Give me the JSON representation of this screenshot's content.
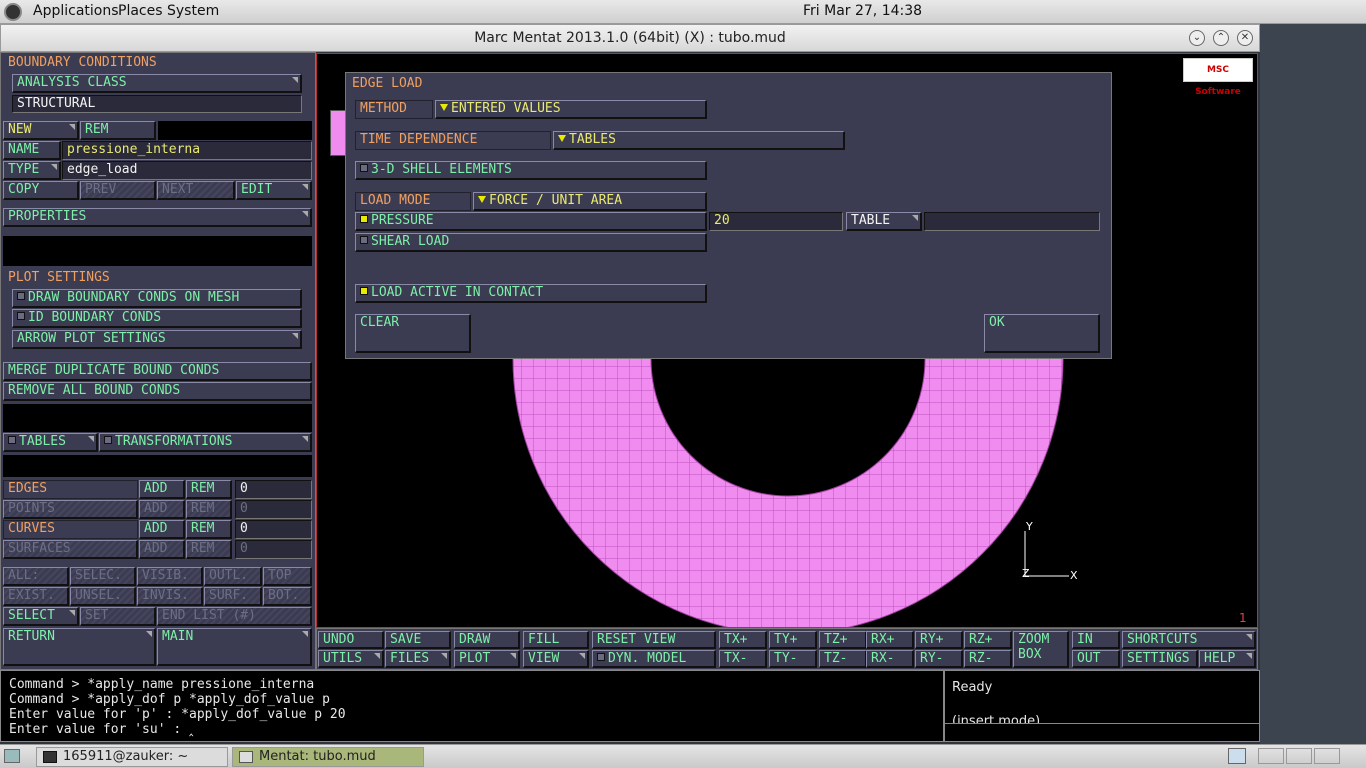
{
  "top_panel": {
    "applications": "Applications",
    "places": "Places",
    "system": "System",
    "clock": "Fri Mar 27, 14:38"
  },
  "window": {
    "title": "Marc Mentat 2013.1.0 (64bit) (X) : tubo.mud"
  },
  "left": {
    "boundary_conditions": "BOUNDARY CONDITIONS",
    "analysis_class": "ANALYSIS CLASS",
    "structural": "STRUCTURAL",
    "new": "NEW",
    "rem": "REM",
    "name_label": "NAME",
    "name_value": "pressione_interna",
    "type_label": "TYPE",
    "type_value": "edge_load",
    "copy": "COPY",
    "prev": "PREV",
    "next": "NEXT",
    "edit": "EDIT",
    "properties": "PROPERTIES",
    "plot_settings": "PLOT SETTINGS",
    "draw_bc": "DRAW BOUNDARY CONDS ON MESH",
    "id_bc": "ID BOUNDARY CONDS",
    "arrow_plot": "ARROW PLOT SETTINGS",
    "merge_dup": "MERGE DUPLICATE BOUND CONDS",
    "remove_all": "REMOVE ALL BOUND CONDS",
    "tables": "TABLES",
    "transformations": "TRANSFORMATIONS",
    "edges": "EDGES",
    "points": "POINTS",
    "curves": "CURVES",
    "surfaces": "SURFACES",
    "add": "ADD",
    "zero": "0",
    "all": "ALL:",
    "selec": "SELEC.",
    "visib": "VISIB.",
    "outl": "OUTL.",
    "top": "TOP",
    "exist": "EXIST.",
    "unsel": "UNSEL.",
    "invis": "INVIS.",
    "surf": "SURF.",
    "bot": "BOT.",
    "select": "SELECT",
    "set": "SET",
    "end_list": "END LIST (#)",
    "return": "RETURN",
    "main": "MAIN"
  },
  "dialog": {
    "title": "EDGE LOAD",
    "method_label": "METHOD",
    "method_value": "ENTERED VALUES",
    "time_dep_label": "TIME DEPENDENCE",
    "time_dep_value": "TABLES",
    "shell": "3-D SHELL ELEMENTS",
    "load_mode_label": "LOAD MODE",
    "load_mode_value": "FORCE / UNIT AREA",
    "pressure": "PRESSURE",
    "pressure_value": "20",
    "table": "TABLE",
    "shear": "SHEAR LOAD",
    "contact": "LOAD ACTIVE IN CONTACT",
    "clear": "CLEAR",
    "ok": "OK"
  },
  "viewport": {
    "logo": "MSC Software",
    "axis_y": "Y",
    "axis_x": "X",
    "axis_z": "Z",
    "viewport_number": "1",
    "mesh_color": "#f08cf0"
  },
  "toolbar": {
    "undo": "UNDO",
    "save": "SAVE",
    "draw": "DRAW",
    "fill": "FILL",
    "reset_view": "RESET VIEW",
    "txp": "TX+",
    "typ": "TY+",
    "tzp": "TZ+",
    "rxp": "RX+",
    "ryp": "RY+",
    "rzp": "RZ+",
    "zoom": "ZOOM",
    "box": "BOX",
    "in": "IN",
    "shortcuts": "SHORTCUTS",
    "utils": "UTILS",
    "files": "FILES",
    "plot": "PLOT",
    "view": "VIEW",
    "dyn_model": "DYN. MODEL",
    "txm": "TX-",
    "tym": "TY-",
    "tzm": "TZ-",
    "rxm": "RX-",
    "rym": "RY-",
    "rzm": "RZ-",
    "out": "OUT",
    "settings": "SETTINGS",
    "help": "HELP"
  },
  "command": {
    "lines": [
      "Command > *apply_name pressione_interna",
      "Command > *apply_dof p *apply_dof_value p",
      "Enter value for 'p' : *apply_dof_value p 20",
      "Enter value for 'su' :"
    ]
  },
  "status": {
    "ready": "Ready",
    "mode": "(insert mode)"
  },
  "taskbar": {
    "terminal": "165911@zauker: ~",
    "mentat": "Mentat: tubo.mud"
  }
}
